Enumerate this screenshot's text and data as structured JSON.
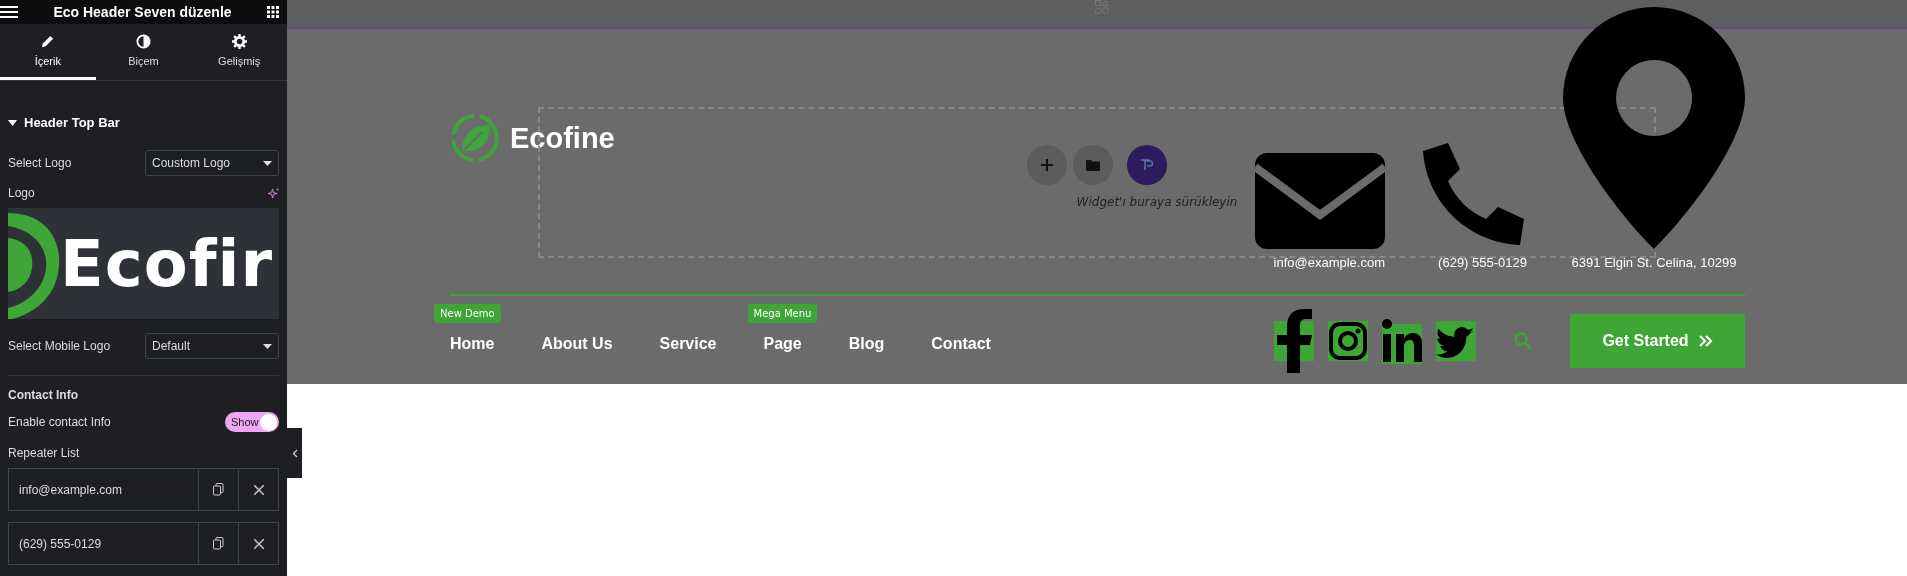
{
  "panel": {
    "title": "Eco Header Seven düzenle",
    "tabs": [
      {
        "label": "İçerik",
        "kind": "pencil",
        "selected": true
      },
      {
        "label": "Biçem",
        "kind": "contrast",
        "selected": false
      },
      {
        "label": "Gelişmiş",
        "kind": "gear",
        "selected": false
      }
    ],
    "section": {
      "title": "Header Top Bar",
      "expanded": true
    },
    "select_logo": {
      "label": "Select Logo",
      "value": "Coustom Logo"
    },
    "logo": {
      "label": "Logo",
      "preview_text": "Ecofir"
    },
    "select_mobile_logo": {
      "label": "Select Mobile Logo",
      "value": "Default"
    },
    "contact_heading": "Contact Info",
    "enable_contact": {
      "label": "Enable contact Info",
      "on": true,
      "text": "Show"
    },
    "repeater": {
      "label": "Repeater List",
      "items": [
        "info@example.com",
        "(629) 555-0129"
      ]
    }
  },
  "canvas": {
    "logo_text": "Ecofine",
    "drop_zone": {
      "hint": "Widget'ı buraya sürükleyin"
    },
    "contacts": [
      {
        "kind": "mail",
        "text": "info@example.com"
      },
      {
        "kind": "phone",
        "text": "(629) 555-0129"
      },
      {
        "kind": "pin",
        "text": "6391 Elgin St. Celina, 10299"
      }
    ],
    "nav": [
      {
        "label": "Home",
        "badge": "New Demo"
      },
      {
        "label": "About Us"
      },
      {
        "label": "Service"
      },
      {
        "label": "Page",
        "badge": "Mega Menu"
      },
      {
        "label": "Blog"
      },
      {
        "label": "Contact"
      }
    ],
    "social": [
      {
        "kind": "facebook"
      },
      {
        "kind": "instagram"
      },
      {
        "kind": "linkedin"
      },
      {
        "kind": "twitter"
      }
    ],
    "button": "Get Started"
  }
}
